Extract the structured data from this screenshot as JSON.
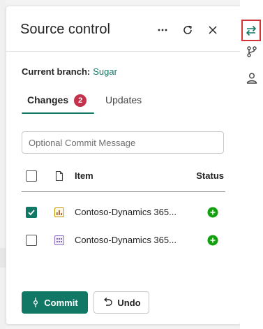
{
  "panel": {
    "title": "Source control",
    "current_branch_label": "Current branch:",
    "current_branch_value": "Sugar",
    "tabs": [
      {
        "label": "Changes",
        "badge": "2",
        "selected": true
      },
      {
        "label": "Updates",
        "selected": false
      }
    ],
    "commit_message_placeholder": "Optional Commit Message",
    "table": {
      "headers": {
        "item": "Item",
        "status": "Status"
      },
      "rows": [
        {
          "name": "Contoso-Dynamics 365...",
          "checked": true,
          "type_icon": "report-icon",
          "status_icon": "added-icon"
        },
        {
          "name": "Contoso-Dynamics 365...",
          "checked": false,
          "type_icon": "semantic-model-icon",
          "status_icon": "added-icon"
        }
      ]
    },
    "buttons": {
      "commit": "Commit",
      "undo": "Undo"
    }
  },
  "icons": {
    "more": "more-icon",
    "refresh": "refresh-icon",
    "close": "close-icon",
    "rail": [
      "source-control-icon",
      "branch-icon",
      "user-icon"
    ]
  },
  "colors": {
    "accent": "#117865",
    "badge": "#c4314b",
    "added": "#13a10e",
    "highlight": "#d13438"
  }
}
